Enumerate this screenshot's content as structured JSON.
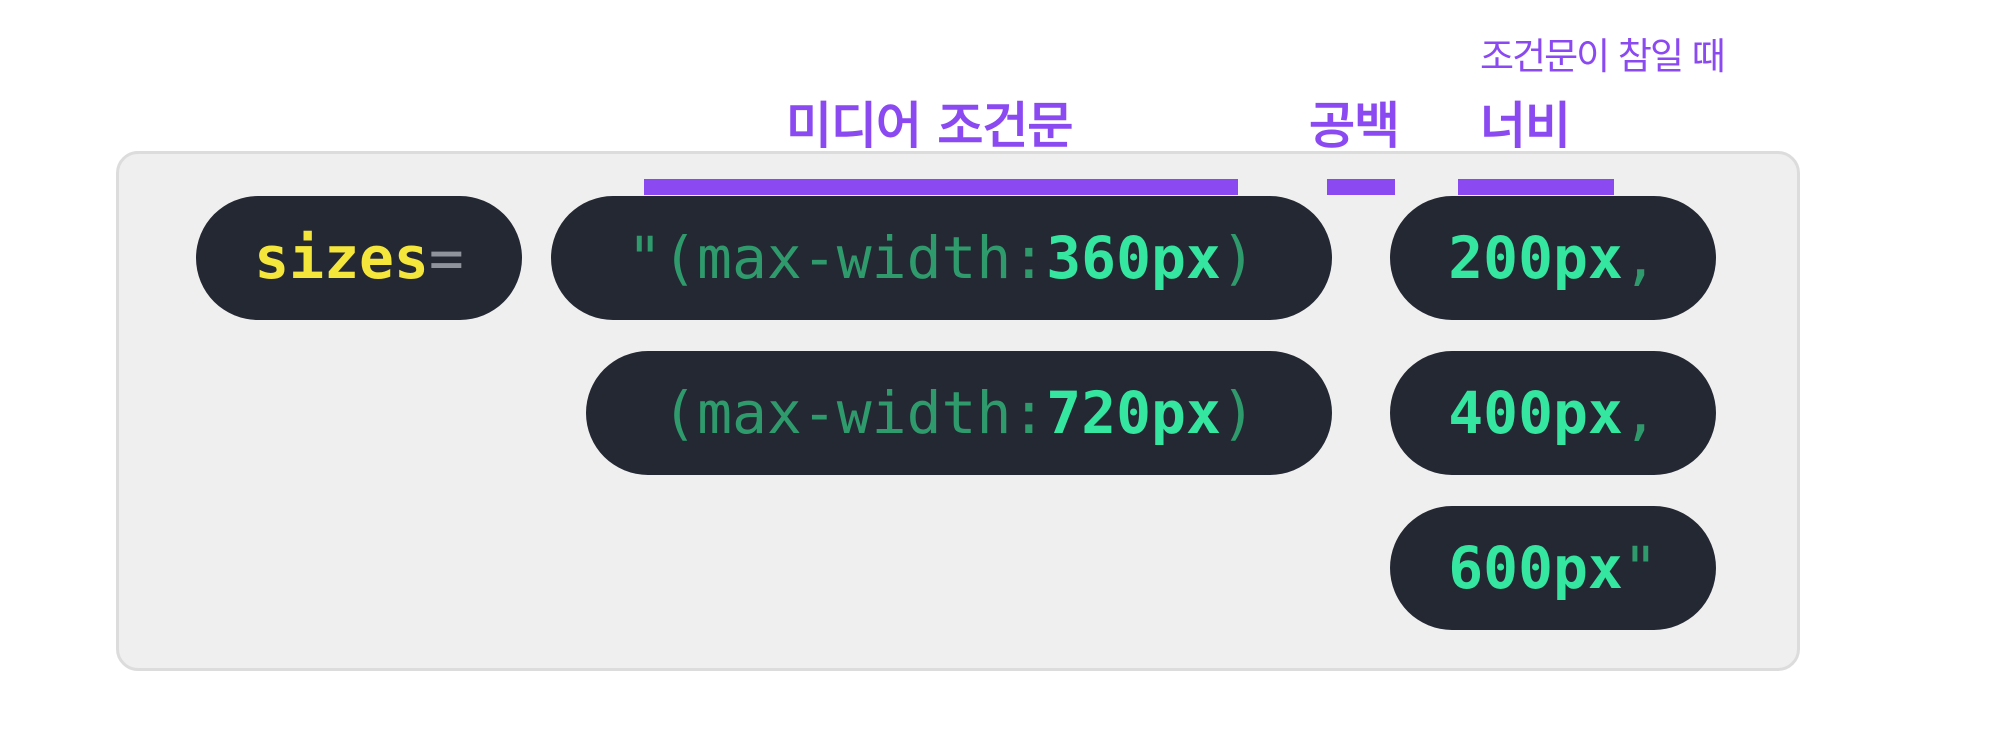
{
  "labels": {
    "media_condition": "미디어 조건문",
    "space": "공백",
    "width": "너비",
    "width_note": "조건문이 참일 때"
  },
  "attribute": {
    "name": "sizes",
    "equals": "="
  },
  "conditions": [
    {
      "prefix": "\"(max-width: ",
      "value": "360px",
      "suffix": ")"
    },
    {
      "prefix": "(max-width: ",
      "value": "720px",
      "suffix": ")"
    }
  ],
  "widths": [
    {
      "value": "200px",
      "suffix": ","
    },
    {
      "value": "400px",
      "suffix": ","
    },
    {
      "value": "600px",
      "suffix": "\""
    }
  ],
  "colors": {
    "accent": "#8b49f2",
    "pill_bg": "#242833",
    "attribute": "#f5e63c",
    "code_dim": "#2f9b6d",
    "code_highlight": "#34e6a0",
    "panel_bg": "#efefef"
  }
}
